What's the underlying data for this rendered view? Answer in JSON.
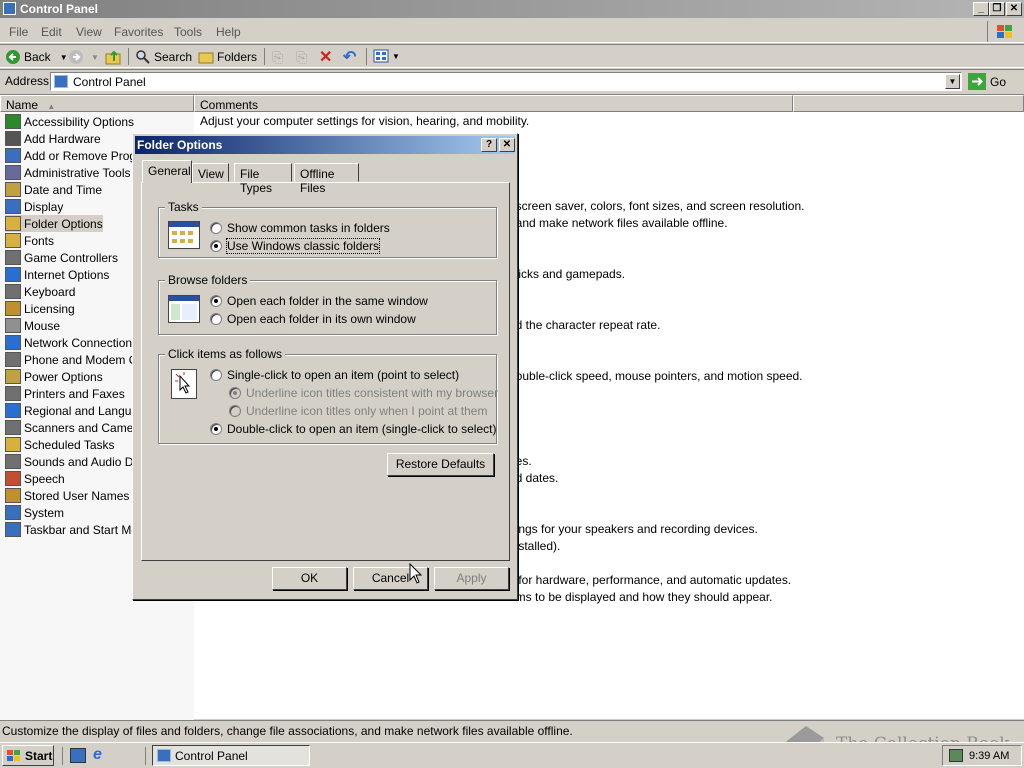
{
  "window": {
    "title": "Control Panel",
    "min": "_",
    "max": "❐",
    "close": "✕"
  },
  "menu": {
    "file": "File",
    "edit": "Edit",
    "view": "View",
    "favorites": "Favorites",
    "tools": "Tools",
    "help": "Help"
  },
  "toolbar": {
    "back": "Back",
    "search": "Search",
    "folders": "Folders"
  },
  "address": {
    "label": "Address",
    "value": "Control Panel",
    "go": "Go"
  },
  "columns": {
    "name": "Name",
    "comments": "Comments"
  },
  "items": [
    {
      "label": "Accessibility Options",
      "color": "#2a8a2a"
    },
    {
      "label": "Add Hardware",
      "color": "#555555"
    },
    {
      "label": "Add or Remove Progra",
      "color": "#3a6fbf"
    },
    {
      "label": "Administrative Tools",
      "color": "#6a6a9a"
    },
    {
      "label": "Date and Time",
      "color": "#c0a040"
    },
    {
      "label": "Display",
      "color": "#3a6fbf"
    },
    {
      "label": "Folder Options",
      "color": "#d8b040"
    },
    {
      "label": "Fonts",
      "color": "#d8b040"
    },
    {
      "label": "Game Controllers",
      "color": "#707070"
    },
    {
      "label": "Internet Options",
      "color": "#2a6fd0"
    },
    {
      "label": "Keyboard",
      "color": "#707070"
    },
    {
      "label": "Licensing",
      "color": "#c09030"
    },
    {
      "label": "Mouse",
      "color": "#909090"
    },
    {
      "label": "Network Connections",
      "color": "#2a6fd0"
    },
    {
      "label": "Phone and Modem Opt",
      "color": "#707070"
    },
    {
      "label": "Power Options",
      "color": "#c0a040"
    },
    {
      "label": "Printers and Faxes",
      "color": "#707070"
    },
    {
      "label": "Regional and Language",
      "color": "#2a6fd0"
    },
    {
      "label": "Scanners and Cameras",
      "color": "#707070"
    },
    {
      "label": "Scheduled Tasks",
      "color": "#d8b040"
    },
    {
      "label": "Sounds and Audio Dev",
      "color": "#707070"
    },
    {
      "label": "Speech",
      "color": "#c05030"
    },
    {
      "label": "Stored User Names an",
      "color": "#c09030"
    },
    {
      "label": "System",
      "color": "#3a6fbf"
    },
    {
      "label": "Taskbar and Start Men",
      "color": "#3a6fbf"
    }
  ],
  "comments": [
    "Adjust your computer settings for vision, hearing, and mobility.",
    "",
    "",
    "",
    "",
    ", screen saver, colors, font sizes, and screen resolution.",
    ", and make network files available offline.",
    "",
    "",
    "sticks and gamepads.",
    "",
    "",
    "nd the character repeat rate.",
    "",
    "",
    "double-click speed, mouse pointers, and motion speed.",
    "",
    "",
    "",
    "",
    "nes.",
    "nd dates.",
    "",
    "",
    "ttings for your speakers and recording devices.",
    "installed).",
    "",
    "s for hardware, performance, and automatic updates.",
    "ems to be displayed and how they should appear."
  ],
  "status": "Customize the display of files and folders, change file associations, and make network files available offline.",
  "taskbar": {
    "start": "Start",
    "task": "Control Panel",
    "clock": "9:39 AM"
  },
  "watermark": "The Collection Book",
  "dialog": {
    "title": "Folder Options",
    "help": "?",
    "close": "✕",
    "tabs": [
      "General",
      "View",
      "File Types",
      "Offline Files"
    ],
    "tasks": {
      "title": "Tasks",
      "opt1": "Show common tasks in folders",
      "opt2": "Use Windows classic folders",
      "selected": 2
    },
    "browse": {
      "title": "Browse folders",
      "opt1": "Open each folder in the same window",
      "opt2": "Open each folder in its own window",
      "selected": 1
    },
    "click": {
      "title": "Click items as follows",
      "single": "Single-click to open an item (point to select)",
      "sub1": "Underline icon titles consistent with my browser",
      "sub2": "Underline icon titles only when I point at them",
      "double": "Double-click to open an item (single-click to select)",
      "selected": "double"
    },
    "restore": "Restore Defaults",
    "ok": "OK",
    "cancel": "Cancel",
    "apply": "Apply"
  }
}
